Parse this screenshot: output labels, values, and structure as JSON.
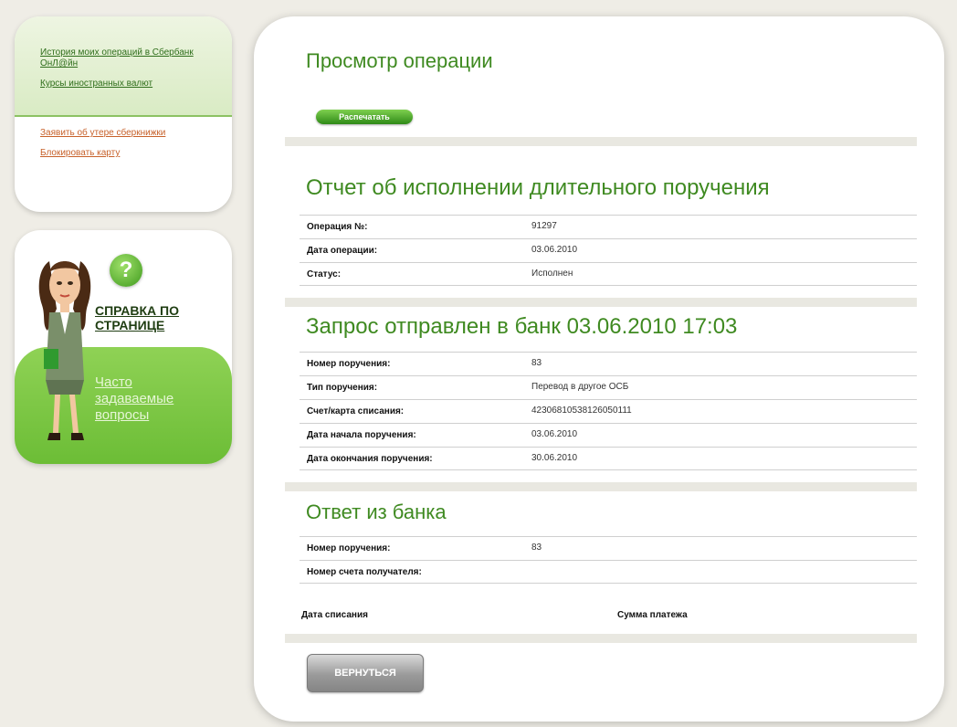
{
  "sidebar": {
    "links_top": [
      {
        "label": "История моих операций в Сбербанк ОнЛ@йн"
      },
      {
        "label": "Курсы иностранных валют"
      }
    ],
    "links_bottom": [
      {
        "label": "Заявить об утере сберкнижки"
      },
      {
        "label": "Блокировать карту"
      }
    ],
    "help": {
      "badge": "?",
      "title": "СПРАВКА ПО СТРАНИЦЕ",
      "faq": "Часто задаваемые вопросы"
    }
  },
  "main": {
    "page_title": "Просмотр операции",
    "print_label": "Распечатать",
    "section1": {
      "title": "Отчет об исполнении длительного поручения",
      "rows": [
        {
          "label": "Операция №:",
          "value": "91297"
        },
        {
          "label": "Дата операции:",
          "value": "03.06.2010"
        },
        {
          "label": "Статус:",
          "value": "Исполнен"
        }
      ]
    },
    "section2": {
      "title": "Запрос отправлен в банк 03.06.2010 17:03",
      "rows": [
        {
          "label": "Номер поручения:",
          "value": "83"
        },
        {
          "label": "Тип поручения:",
          "value": "Перевод в другое ОСБ"
        },
        {
          "label": "Счет/карта списания:",
          "value": "42306810538126050111"
        },
        {
          "label": "Дата начала поручения:",
          "value": "03.06.2010"
        },
        {
          "label": "Дата окончания поручения:",
          "value": "30.06.2010"
        }
      ]
    },
    "section3": {
      "title": "Ответ из банка",
      "rows": [
        {
          "label": "Номер поручения:",
          "value": "83"
        },
        {
          "label": "Номер счета получателя:",
          "value": ""
        }
      ],
      "table_headers": [
        "Дата списания",
        "Сумма платежа"
      ]
    },
    "back_label": "ВЕРНУТЬСЯ"
  },
  "colors": {
    "accent_green": "#3f8a21",
    "link_orange": "#c7612a",
    "background": "#efede6"
  }
}
